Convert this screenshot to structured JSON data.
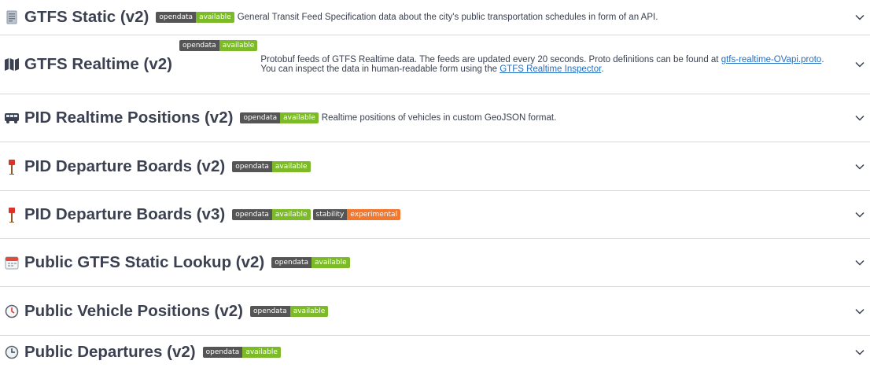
{
  "rows": [
    {
      "icon": "document-icon",
      "title": "GTFS Static (v2)",
      "badges": [
        {
          "key": "opendata",
          "value": "available",
          "color": "#7cba2a"
        }
      ],
      "description": "General Transit Feed Specification data about the city's public transportation schedules in form of an API."
    },
    {
      "icon": "map-icon",
      "title": "GTFS Realtime (v2)",
      "badges": [
        {
          "key": "opendata",
          "value": "available",
          "color": "#7cba2a"
        }
      ],
      "description_parts": [
        {
          "text": "Protobuf feeds of GTFS Realtime data. The feeds are updated every 20 seconds. Proto definitions can be found at "
        },
        {
          "text": "gtfs-realtime-OVapi.proto",
          "link": true
        },
        {
          "text": ". You can inspect the data in human-readable form using the "
        },
        {
          "text": "GTFS Realtime Inspector",
          "link": true
        },
        {
          "text": "."
        }
      ]
    },
    {
      "icon": "bus-icon",
      "title": "PID Realtime Positions (v2)",
      "badges": [
        {
          "key": "opendata",
          "value": "available",
          "color": "#7cba2a"
        }
      ],
      "description": "Realtime positions of vehicles in custom GeoJSON format."
    },
    {
      "icon": "bus-stop-icon",
      "title": "PID Departure Boards (v2)",
      "badges": [
        {
          "key": "opendata",
          "value": "available",
          "color": "#7cba2a"
        }
      ],
      "description": ""
    },
    {
      "icon": "bus-stop-icon",
      "title": "PID Departure Boards (v3)",
      "badges": [
        {
          "key": "opendata",
          "value": "available",
          "color": "#7cba2a"
        },
        {
          "key": "stability",
          "value": "experimental",
          "color": "#f3772c"
        }
      ],
      "description": ""
    },
    {
      "icon": "calendar-icon",
      "title": "Public GTFS Static Lookup (v2)",
      "badges": [
        {
          "key": "opendata",
          "value": "available",
          "color": "#7cba2a"
        }
      ],
      "description": ""
    },
    {
      "icon": "stopwatch-icon",
      "title": "Public Vehicle Positions (v2)",
      "badges": [
        {
          "key": "opendata",
          "value": "available",
          "color": "#7cba2a"
        }
      ],
      "description": ""
    },
    {
      "icon": "clock-icon",
      "title": "Public Departures (v2)",
      "badges": [
        {
          "key": "opendata",
          "value": "available",
          "color": "#7cba2a"
        }
      ],
      "description": ""
    }
  ],
  "expand_icon": "chevron-down-icon"
}
